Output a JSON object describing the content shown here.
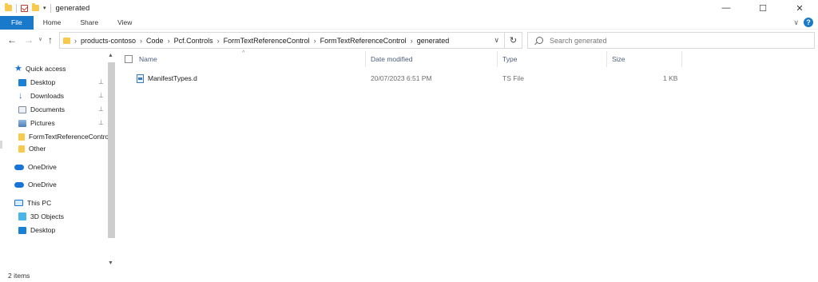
{
  "window": {
    "title": "generated",
    "controls": {
      "minimize": "—",
      "maximize": "☐",
      "close": "✕"
    }
  },
  "ribbon": {
    "tabs": [
      "File",
      "Home",
      "Share",
      "View"
    ],
    "expand_glyph": "∨",
    "help_glyph": "?"
  },
  "address": {
    "breadcrumbs": [
      "products-contoso",
      "Code",
      "Pcf.Controls",
      "FormTextReferenceControl",
      "FormTextReferenceControl",
      "generated"
    ],
    "separator": "›",
    "dropdown_glyph": "∨",
    "refresh_glyph": "↻"
  },
  "search": {
    "placeholder": "Search generated"
  },
  "nav_buttons": {
    "back": "←",
    "forward": "→",
    "recent": "∨",
    "up": "↑"
  },
  "sidebar": {
    "quick_access": "Quick access",
    "items": [
      {
        "label": "Desktop",
        "icon": "desktop-icon",
        "pinned": true
      },
      {
        "label": "Downloads",
        "icon": "downloads-icon",
        "pinned": true
      },
      {
        "label": "Documents",
        "icon": "documents-icon",
        "pinned": true
      },
      {
        "label": "Pictures",
        "icon": "pictures-icon",
        "pinned": true
      },
      {
        "label": "FormTextReferenceControl",
        "icon": "folder-icon",
        "pinned": false
      },
      {
        "label": "Other",
        "icon": "folder-icon",
        "pinned": false
      }
    ],
    "onedrive_1": "OneDrive",
    "onedrive_2": "OneDrive",
    "this_pc": "This PC",
    "pc_items": [
      {
        "label": "3D Objects",
        "icon": "3d-objects-icon"
      },
      {
        "label": "Desktop",
        "icon": "desktop-icon"
      }
    ],
    "pin_glyph": "📌"
  },
  "columns": {
    "name": "Name",
    "date": "Date modified",
    "type": "Type",
    "size": "Size"
  },
  "files": [
    {
      "name": "ManifestTypes.d",
      "date": "20/07/2023 6:51 PM",
      "type": "TS File",
      "size": "1 KB"
    }
  ],
  "status": {
    "item_count": "2 items"
  },
  "colors": {
    "accent": "#1979ca",
    "folder": "#f8c94c"
  }
}
